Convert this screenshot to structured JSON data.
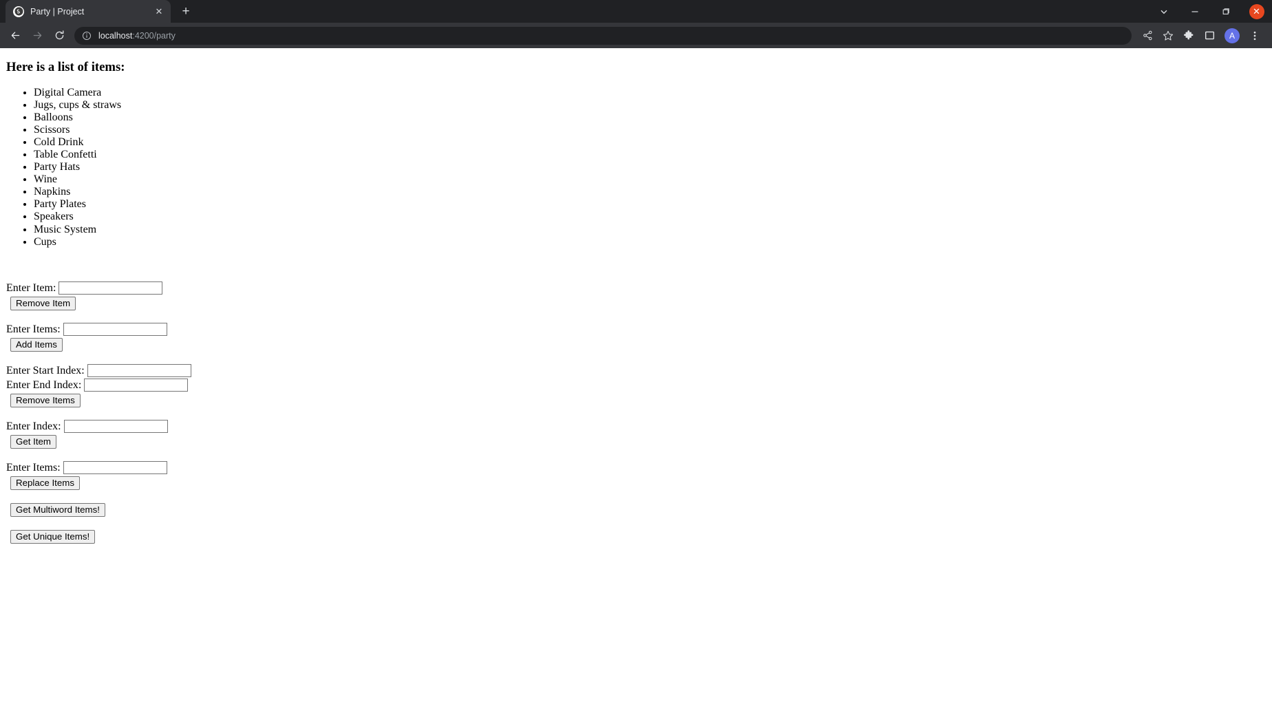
{
  "browser": {
    "tab": {
      "title": "Party | Project",
      "favicon_name": "angular-favicon",
      "close_label": "✕"
    },
    "new_tab_label": "+",
    "window_controls": {
      "chevron_label": "⌄",
      "minimize_label": "—",
      "maximize_label": "❐",
      "close_label": "✕"
    },
    "toolbar": {
      "back_label": "←",
      "forward_label": "→",
      "reload_label": "⟳",
      "site_info_label": "ⓘ",
      "url_host": "localhost",
      "url_path": ":4200/party",
      "share_label": "share-icon",
      "bookmark_label": "☆",
      "extensions_label": "extensions-icon",
      "side_panel_label": "side-panel-icon",
      "avatar_label": "A",
      "menu_label": "⋮"
    }
  },
  "page": {
    "heading": "Here is a list of items:",
    "items": [
      "Digital Camera",
      "Jugs, cups & straws",
      "Balloons",
      "Scissors",
      "Cold Drink",
      "Table Confetti",
      "Party Hats",
      "Wine",
      "Napkins",
      "Party Plates",
      "Speakers",
      "Music System",
      "Cups"
    ],
    "forms": {
      "remove_item": {
        "label": "Enter Item:",
        "value": "",
        "placeholder": "",
        "button": "Remove Item"
      },
      "add_items": {
        "label": "Enter Items:",
        "value": "",
        "placeholder": "",
        "button": "Add Items"
      },
      "remove_range": {
        "start_label": "Enter Start Index:",
        "start_value": "",
        "end_label": "Enter End Index:",
        "end_value": "",
        "button": "Remove Items"
      },
      "get_item": {
        "label": "Enter Index:",
        "value": "",
        "placeholder": "",
        "button": "Get Item"
      },
      "replace_items": {
        "label": "Enter Items:",
        "value": "",
        "placeholder": "",
        "button": "Replace Items"
      },
      "multiword_button": "Get Multiword Items!",
      "unique_button": "Get Unique Items!"
    }
  }
}
